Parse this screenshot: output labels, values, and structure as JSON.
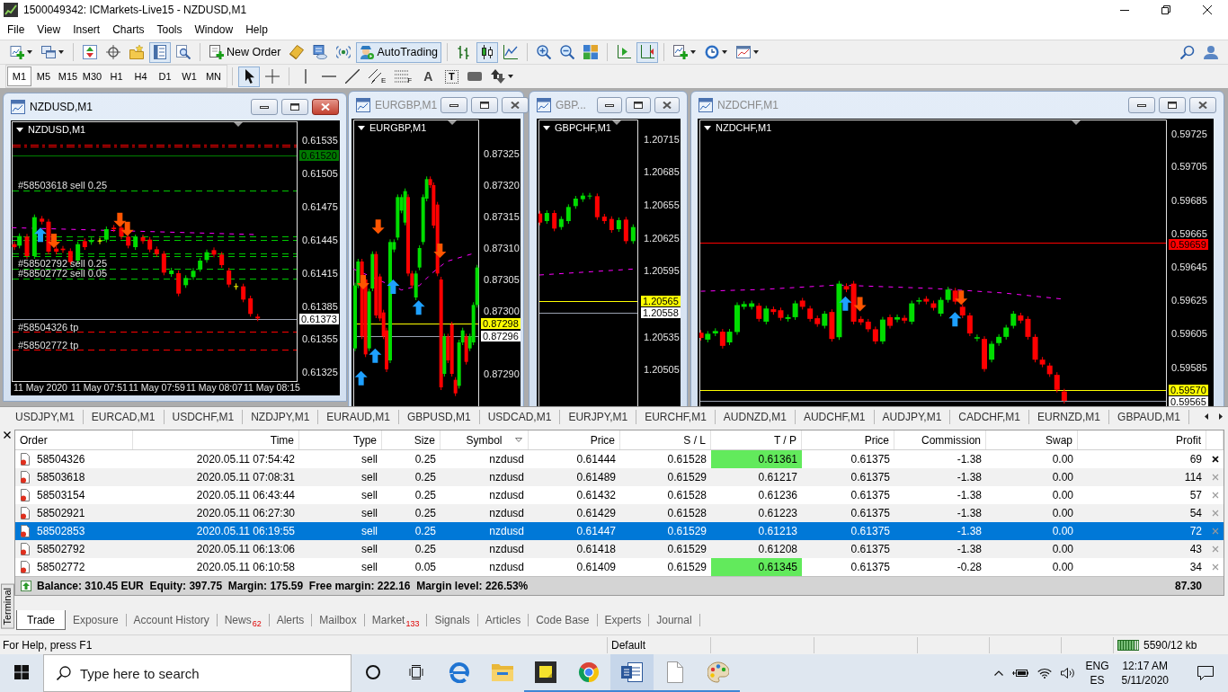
{
  "window": {
    "title": "1500049342: ICMarkets-Live15 - NZDUSD,M1"
  },
  "menu": [
    "File",
    "View",
    "Insert",
    "Charts",
    "Tools",
    "Window",
    "Help"
  ],
  "toolbar": [
    [
      {
        "kind": "new-chart",
        "pressed": false,
        "dropdown": true
      },
      {
        "kind": "profiles",
        "pressed": false,
        "dropdown": true
      }
    ],
    [
      {
        "kind": "market-watch",
        "pressed": false
      },
      {
        "kind": "navigator",
        "pressed": false
      },
      {
        "kind": "favorites",
        "pressed": false
      },
      {
        "kind": "data-window",
        "pressed": true
      },
      {
        "kind": "tester",
        "pressed": false
      }
    ],
    [
      {
        "kind": "new-order",
        "pressed": false,
        "label": "New Order"
      },
      {
        "kind": "editor",
        "pressed": false
      },
      {
        "kind": "database",
        "pressed": false
      },
      {
        "kind": "signals",
        "pressed": false
      },
      {
        "kind": "autotrading",
        "pressed": true,
        "label": "AutoTrading"
      }
    ],
    [
      {
        "kind": "bar-chart",
        "pressed": false
      },
      {
        "kind": "candle-chart",
        "pressed": true
      },
      {
        "kind": "line-chart",
        "pressed": false
      }
    ],
    [
      {
        "kind": "zoom-in",
        "pressed": false
      },
      {
        "kind": "zoom-out",
        "pressed": false
      },
      {
        "kind": "tile",
        "pressed": false
      }
    ],
    [
      {
        "kind": "auto-scroll",
        "pressed": false
      },
      {
        "kind": "chart-shift",
        "pressed": true
      }
    ],
    [
      {
        "kind": "indicators",
        "pressed": false,
        "dropdown": true
      },
      {
        "kind": "periods",
        "pressed": false,
        "dropdown": true
      },
      {
        "kind": "templates",
        "pressed": false,
        "dropdown": true
      }
    ]
  ],
  "timeframes": [
    {
      "label": "M1",
      "selected": true
    },
    {
      "label": "M5",
      "selected": false
    },
    {
      "label": "M15",
      "selected": false
    },
    {
      "label": "M30",
      "selected": false
    },
    {
      "label": "H1",
      "selected": false
    },
    {
      "label": "H4",
      "selected": false
    },
    {
      "label": "D1",
      "selected": false
    },
    {
      "label": "W1",
      "selected": false
    },
    {
      "label": "MN",
      "selected": false
    }
  ],
  "draw_tools": [
    [
      {
        "kind": "cursor",
        "pressed": true
      },
      {
        "kind": "crosshair",
        "pressed": false
      }
    ],
    [
      {
        "kind": "vline",
        "pressed": false
      },
      {
        "kind": "hline",
        "pressed": false
      },
      {
        "kind": "trendline",
        "pressed": false
      },
      {
        "kind": "channel",
        "pressed": false,
        "glyph": "E"
      },
      {
        "kind": "fibo",
        "pressed": false,
        "glyph": "F"
      },
      {
        "kind": "text",
        "pressed": false,
        "glyph": "A"
      },
      {
        "kind": "label",
        "pressed": false,
        "glyph": "T"
      },
      {
        "kind": "shape",
        "pressed": false
      },
      {
        "kind": "arrows",
        "pressed": false,
        "dropdown": true
      }
    ]
  ],
  "chart_windows": [
    {
      "title": "NZDUSD,M1",
      "active": true,
      "symbol": "NZDUSD,M1",
      "price_ticks": [
        "0.61535",
        "0.61505",
        "0.61475",
        "0.61445",
        "0.61415",
        "0.61385",
        "0.61355",
        "0.61325"
      ],
      "price_markers": [
        {
          "text": "0.61520",
          "color": "#007800"
        },
        {
          "text": "0.61373",
          "color": "#ffffff"
        }
      ],
      "time_ticks": [
        "11 May 2020",
        "11 May 07:51",
        "11 May 07:59",
        "11 May 08:07",
        "11 May 08:15"
      ],
      "order_labels": [
        "#58503618 sell 0.25",
        "#58502792 sell 0.25",
        "#58502772 sell 0.05",
        "#58504326 tp",
        "#58502772 tp"
      ]
    },
    {
      "title": "EURGBP,M1",
      "active": false,
      "symbol": "EURGBP,M1",
      "price_ticks": [
        "0.87325",
        "0.87320",
        "0.87315",
        "0.87310",
        "0.87305",
        "0.87300",
        "0.87290"
      ],
      "price_markers": [
        {
          "text": "0.87298",
          "color": "#ffff00"
        },
        {
          "text": "0.87296",
          "color": "#ffffff"
        }
      ]
    },
    {
      "title": "GBP...",
      "active": false,
      "symbol": "GBPCHF,M1",
      "price_ticks": [
        "1.20715",
        "1.20685",
        "1.20655",
        "1.20625",
        "1.20595",
        "1.20535",
        "1.20505"
      ],
      "price_markers": [
        {
          "text": "1.20565",
          "color": "#ffff00"
        },
        {
          "text": "1.20558",
          "color": "#ffffff"
        }
      ]
    },
    {
      "title": "NZDCHF,M1",
      "active": false,
      "symbol": "NZDCHF,M1",
      "price_ticks": [
        "0.59725",
        "0.59705",
        "0.59685",
        "0.59665",
        "0.59645",
        "0.59625",
        "0.59605",
        "0.59585"
      ],
      "price_markers": [
        {
          "text": "0.59659",
          "color": "#ff0000"
        },
        {
          "text": "0.59570",
          "color": "#ffff00"
        },
        {
          "text": "0.59565",
          "color": "#ffffff"
        }
      ]
    }
  ],
  "symbol_tabs": [
    "USDJPY,M1",
    "EURCAD,M1",
    "USDCHF,M1",
    "NZDJPY,M1",
    "EURAUD,M1",
    "GBPUSD,M1",
    "USDCAD,M1",
    "EURJPY,M1",
    "EURCHF,M1",
    "AUDNZD,M1",
    "AUDCHF,M1",
    "AUDJPY,M1",
    "CADCHF,M1",
    "EURNZD,M1",
    "GBPAUD,M1"
  ],
  "terminal": {
    "side_label": "Terminal",
    "columns": [
      {
        "label": "Order",
        "sorted": false
      },
      {
        "label": "Time",
        "sorted": false
      },
      {
        "label": "Type",
        "sorted": false
      },
      {
        "label": "Size",
        "sorted": false
      },
      {
        "label": "Symbol",
        "sorted": true
      },
      {
        "label": "Price",
        "sorted": false
      },
      {
        "label": "S / L",
        "sorted": false
      },
      {
        "label": "T / P",
        "sorted": false
      },
      {
        "label": "Price",
        "sorted": false
      },
      {
        "label": "Commission",
        "sorted": false
      },
      {
        "label": "Swap",
        "sorted": false
      },
      {
        "label": "Profit",
        "sorted": false
      }
    ],
    "rows": [
      {
        "selected": false,
        "tp_highlighted": true,
        "close_hover": true,
        "cells": [
          "58504326",
          "2020.05.11 07:54:42",
          "sell",
          "0.25",
          "nzdusd",
          "0.61444",
          "0.61528",
          "0.61361",
          "0.61375",
          "-1.38",
          "0.00",
          "69"
        ]
      },
      {
        "selected": false,
        "tp_highlighted": false,
        "close_hover": false,
        "cells": [
          "58503618",
          "2020.05.11 07:08:31",
          "sell",
          "0.25",
          "nzdusd",
          "0.61489",
          "0.61529",
          "0.61217",
          "0.61375",
          "-1.38",
          "0.00",
          "114"
        ]
      },
      {
        "selected": false,
        "tp_highlighted": false,
        "close_hover": false,
        "cells": [
          "58503154",
          "2020.05.11 06:43:44",
          "sell",
          "0.25",
          "nzdusd",
          "0.61432",
          "0.61528",
          "0.61236",
          "0.61375",
          "-1.38",
          "0.00",
          "57"
        ]
      },
      {
        "selected": false,
        "tp_highlighted": false,
        "close_hover": false,
        "cells": [
          "58502921",
          "2020.05.11 06:27:30",
          "sell",
          "0.25",
          "nzdusd",
          "0.61429",
          "0.61528",
          "0.61223",
          "0.61375",
          "-1.38",
          "0.00",
          "54"
        ]
      },
      {
        "selected": true,
        "tp_highlighted": false,
        "close_hover": false,
        "cells": [
          "58502853",
          "2020.05.11 06:19:55",
          "sell",
          "0.25",
          "nzdusd",
          "0.61447",
          "0.61529",
          "0.61213",
          "0.61375",
          "-1.38",
          "0.00",
          "72"
        ]
      },
      {
        "selected": false,
        "tp_highlighted": false,
        "close_hover": false,
        "cells": [
          "58502792",
          "2020.05.11 06:13:06",
          "sell",
          "0.25",
          "nzdusd",
          "0.61418",
          "0.61529",
          "0.61208",
          "0.61375",
          "-1.38",
          "0.00",
          "43"
        ]
      },
      {
        "selected": false,
        "tp_highlighted": true,
        "close_hover": false,
        "cells": [
          "58502772",
          "2020.05.11 06:10:58",
          "sell",
          "0.05",
          "nzdusd",
          "0.61409",
          "0.61529",
          "0.61345",
          "0.61375",
          "-0.28",
          "0.00",
          "34"
        ]
      }
    ],
    "summary": {
      "text": "Balance: 310.45 EUR  Equity: 397.75  Margin: 175.59  Free margin: 222.16  Margin level: 226.53%",
      "profit": "87.30"
    },
    "tabs": [
      {
        "label": "Trade",
        "selected": true
      },
      {
        "label": "Exposure",
        "selected": false
      },
      {
        "label": "Account History",
        "selected": false
      },
      {
        "label": "News",
        "selected": false,
        "count": "62"
      },
      {
        "label": "Alerts",
        "selected": false
      },
      {
        "label": "Mailbox",
        "selected": false
      },
      {
        "label": "Market",
        "selected": false,
        "count": "133"
      },
      {
        "label": "Signals",
        "selected": false
      },
      {
        "label": "Articles",
        "selected": false
      },
      {
        "label": "Code Base",
        "selected": false
      },
      {
        "label": "Experts",
        "selected": false
      },
      {
        "label": "Journal",
        "selected": false
      }
    ]
  },
  "status_bar": {
    "help": "For Help, press F1",
    "profile": "Default",
    "traffic": "5590/12 kb"
  },
  "taskbar": {
    "search_placeholder": "Type here to search",
    "apps": [
      {
        "kind": "browser",
        "running": false,
        "active": false
      },
      {
        "kind": "folder",
        "running": false,
        "active": false
      },
      {
        "kind": "note",
        "running": true,
        "active": false
      },
      {
        "kind": "globe",
        "running": true,
        "active": false
      },
      {
        "kind": "document",
        "running": true,
        "active": true
      },
      {
        "kind": "page",
        "running": true,
        "active": false
      },
      {
        "kind": "palette",
        "running": true,
        "active": false
      }
    ],
    "language": [
      "ENG",
      "ES"
    ],
    "clock": [
      "12:17 AM",
      "5/11/2020"
    ]
  }
}
